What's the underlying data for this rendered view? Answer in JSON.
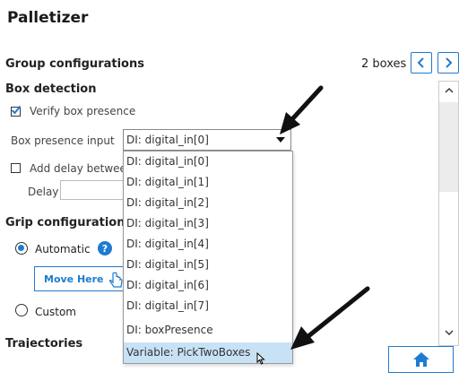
{
  "app": {
    "title": "Palletizer"
  },
  "header": {
    "section_title": "Group configurations",
    "boxes_count": "2 boxes"
  },
  "box_detection": {
    "title": "Box detection",
    "verify_label": "Verify box presence",
    "verify_checked": true,
    "presence_input_label": "Box presence input",
    "presence_input_value": "DI: digital_in[0]",
    "add_delay_label": "Add delay between",
    "add_delay_checked": false,
    "delay_label": "Delay",
    "delay_value": ""
  },
  "grip": {
    "title": "Grip configuration",
    "automatic_label": "Automatic",
    "automatic_selected": true,
    "help_icon": "?",
    "move_here_label": "Move Here",
    "custom_label": "Custom"
  },
  "trajectories": {
    "title": "Trajectories"
  },
  "dropdown": {
    "options": [
      "DI: digital_in[0]",
      "DI: digital_in[1]",
      "DI: digital_in[2]",
      "DI: digital_in[3]",
      "DI: digital_in[4]",
      "DI: digital_in[5]",
      "DI: digital_in[6]",
      "DI: digital_in[7]",
      "DI: boxPresence",
      "Variable: PickTwoBoxes"
    ],
    "highlighted": "Variable: PickTwoBoxes"
  },
  "colors": {
    "accent": "#1f7bd0",
    "highlight": "#c8e2f5",
    "annotation_arrow": "#111111"
  },
  "icons": [
    "checkbox-checked-icon",
    "chevron-left-icon",
    "chevron-right-icon",
    "help-icon",
    "hand-pointer-icon",
    "home-icon",
    "caret-down-icon",
    "scroll-up-icon",
    "scroll-down-icon",
    "mouse-cursor-icon",
    "annotation-arrow-icon"
  ]
}
